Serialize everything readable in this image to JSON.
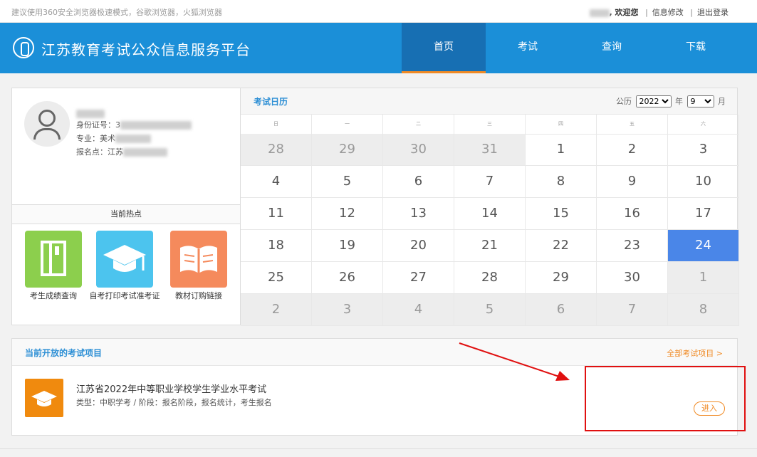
{
  "topbar": {
    "browser_tip": "建议使用360安全浏览器极速模式，谷歌浏览器，火狐浏览器",
    "welcome": ", 欢迎您",
    "edit_info": "信息修改",
    "logout": "退出登录"
  },
  "header": {
    "site_title": "江苏教育考试公众信息服务平台",
    "nav": [
      "首页",
      "考试",
      "查询",
      "下载"
    ]
  },
  "profile": {
    "id_label": "身份证号：3",
    "major_label": "专业：美术",
    "site_label": "报名点：江苏"
  },
  "hot": {
    "title": "当前热点",
    "items": [
      "考生成绩查询",
      "自考打印考试准考证",
      "教材订购链接"
    ]
  },
  "calendar": {
    "title": "考试日历",
    "calendar_label": "公历",
    "year": "2022",
    "year_unit": "年",
    "month": "9",
    "month_unit": "月",
    "weekdays": [
      "日",
      "一",
      "二",
      "三",
      "四",
      "五",
      "六"
    ],
    "days": [
      [
        "28",
        "other"
      ],
      [
        "29",
        "other"
      ],
      [
        "30",
        "other"
      ],
      [
        "31",
        "other"
      ],
      [
        "1",
        ""
      ],
      [
        "2",
        ""
      ],
      [
        "3",
        ""
      ],
      [
        "4",
        ""
      ],
      [
        "5",
        ""
      ],
      [
        "6",
        ""
      ],
      [
        "7",
        ""
      ],
      [
        "8",
        ""
      ],
      [
        "9",
        ""
      ],
      [
        "10",
        ""
      ],
      [
        "11",
        ""
      ],
      [
        "12",
        ""
      ],
      [
        "13",
        ""
      ],
      [
        "14",
        ""
      ],
      [
        "15",
        ""
      ],
      [
        "16",
        ""
      ],
      [
        "17",
        ""
      ],
      [
        "18",
        ""
      ],
      [
        "19",
        ""
      ],
      [
        "20",
        ""
      ],
      [
        "21",
        ""
      ],
      [
        "22",
        ""
      ],
      [
        "23",
        ""
      ],
      [
        "24",
        "today"
      ],
      [
        "25",
        ""
      ],
      [
        "26",
        ""
      ],
      [
        "27",
        ""
      ],
      [
        "28",
        ""
      ],
      [
        "29",
        ""
      ],
      [
        "30",
        ""
      ],
      [
        "1",
        "other"
      ],
      [
        "2",
        "other"
      ],
      [
        "3",
        "other"
      ],
      [
        "4",
        "other"
      ],
      [
        "5",
        "other"
      ],
      [
        "6",
        "other"
      ],
      [
        "7",
        "other"
      ],
      [
        "8",
        "other"
      ]
    ]
  },
  "exams": {
    "section_title": "当前开放的考试项目",
    "all_link": "全部考试项目 >",
    "item": {
      "name": "江苏省2022年中等职业学校学生学业水平考试",
      "meta": "类型：中职学考 / 阶段：报名阶段，报名统计，考生报名",
      "enter": "进入"
    }
  },
  "colors": {
    "header_blue": "#1b8fd8",
    "nav_active": "#176fb3",
    "accent_orange": "#f08a24",
    "today_blue": "#4a86e8",
    "highlight_red": "#e01010"
  }
}
